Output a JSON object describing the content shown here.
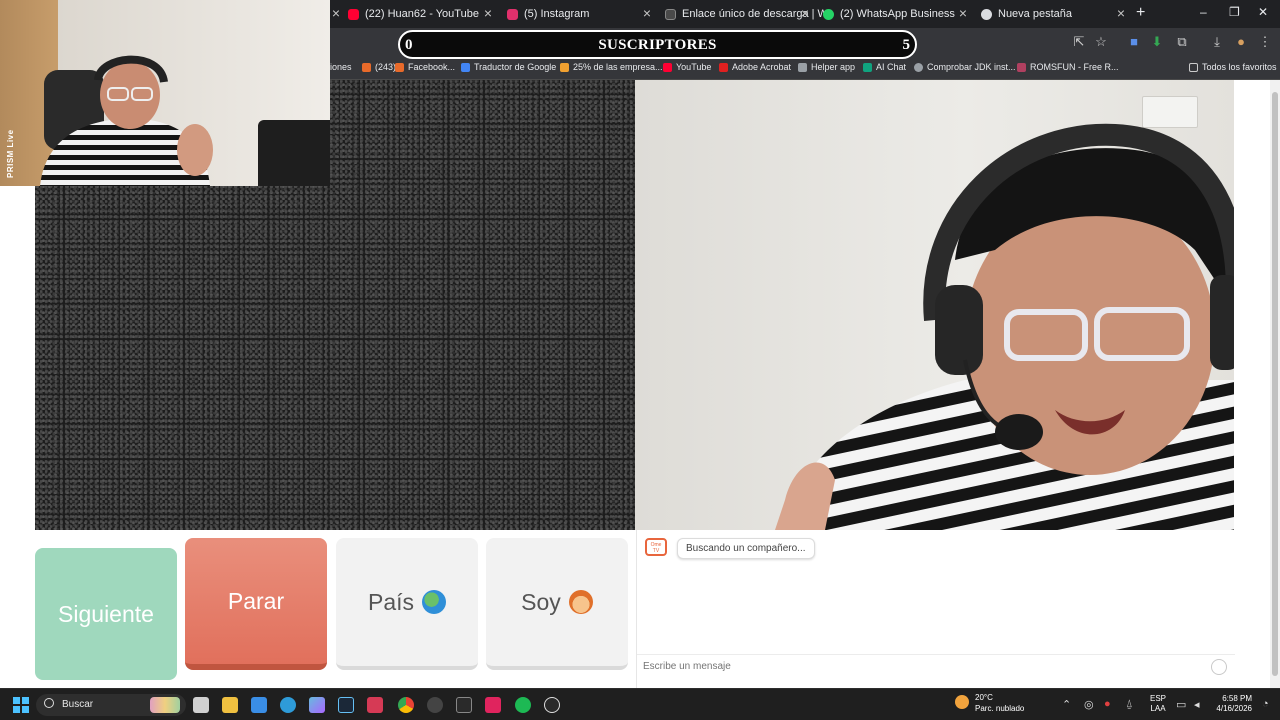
{
  "browser": {
    "tabs": [
      {
        "title": "(22) Huan62 - YouTube",
        "color": "#ff0033"
      },
      {
        "title": "(5) Instagram",
        "color": "#e1306c"
      },
      {
        "title": "Enlace único de descarga | We",
        "color": "#4a4a4a"
      },
      {
        "title": "(2) WhatsApp Business",
        "color": "#25d366"
      },
      {
        "title": "Nueva pestaña",
        "color": "#dadce0"
      }
    ],
    "new_tab": "+",
    "window_controls": {
      "minimize": "–",
      "restore": "❐",
      "close": "✕"
    },
    "bookmarks": [
      {
        "label": "iones",
        "color": "#35363a"
      },
      {
        "label": "(243)",
        "color": "#e86a2a"
      },
      {
        "label": "Facebook...",
        "color": "#e86a2a"
      },
      {
        "label": "Traductor de Google",
        "color": "#4285f4"
      },
      {
        "label": "25% de las empresa...",
        "color": "#f0a030"
      },
      {
        "label": "YouTube",
        "color": "#ff0033"
      },
      {
        "label": "Adobe Acrobat",
        "color": "#e02020"
      },
      {
        "label": "Helper app",
        "color": "#9aa0a6"
      },
      {
        "label": "AI Chat",
        "color": "#10a37f"
      },
      {
        "label": "Comprobar JDK inst...",
        "color": "#9aa0a6"
      },
      {
        "label": "ROMSFUN - Free R...",
        "color": "#b04060"
      }
    ],
    "all_bookmarks": "Todos los favoritos"
  },
  "subscribers_overlay": {
    "left_count": "0",
    "title": "SUSCRIPTORES",
    "right_count": "5"
  },
  "webcam": {
    "label": "PRISM Live"
  },
  "controls": {
    "next_label": "Siguiente",
    "stop_label": "Parar",
    "country_label": "País",
    "country_icon": "globe-icon",
    "soy_label": "Soy",
    "soy_icon": "boy-face-icon"
  },
  "chat": {
    "logo_text": "Ome TV",
    "status_message": "Buscando un compañero...",
    "input_placeholder": "Escribe un mensaje"
  },
  "taskbar": {
    "search_label": "Buscar",
    "weather_temp": "20°C",
    "weather_desc": "Parc. nublado",
    "lang_top": "ESP",
    "lang_bottom": "LAA",
    "time": "6:58 PM",
    "date": "4/16/2026"
  },
  "colors": {
    "next_button": "#9fd8bd",
    "stop_button": "#e1705c",
    "ometv_brand": "#e8663d"
  }
}
